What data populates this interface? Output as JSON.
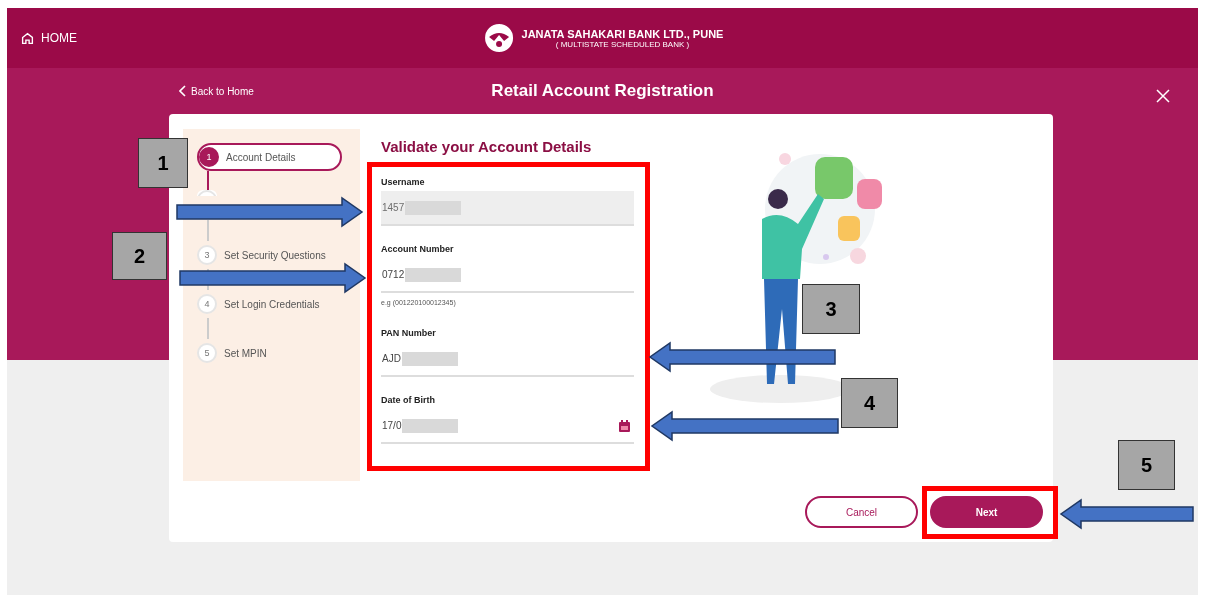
{
  "header": {
    "home_label": "HOME",
    "bank_name": "JANATA SAHAKARI BANK LTD., PUNE",
    "bank_subtitle": "( MULTISTATE SCHEDULED BANK )"
  },
  "subheader": {
    "back_label": "Back to Home",
    "title": "Retail Account Registration"
  },
  "steps": [
    {
      "number": "1",
      "label": "Account Details",
      "selected": true
    },
    {
      "selected": false
    },
    {
      "number": "3",
      "label": "Set Security Questions",
      "selected": false
    },
    {
      "number": "4",
      "label": "Set Login Credentials",
      "selected": false
    },
    {
      "number": "5",
      "label": "Set MPIN",
      "selected": false
    }
  ],
  "form": {
    "heading": "Validate your Account Details",
    "fields": [
      {
        "label": "Username",
        "value": "1457",
        "disabled": true,
        "kind": "text"
      },
      {
        "label": "Account Number",
        "value": "0712",
        "hint": "e.g (001220100012345)",
        "disabled": false,
        "kind": "text"
      },
      {
        "label": "PAN Number",
        "value": "AJD",
        "disabled": false,
        "kind": "text"
      },
      {
        "label": "Date of Birth",
        "value": "17/0",
        "disabled": false,
        "kind": "date"
      }
    ]
  },
  "buttons": {
    "cancel": "Cancel",
    "next": "Next"
  },
  "annotations": [
    {
      "number": "1"
    },
    {
      "number": "2"
    },
    {
      "number": "3"
    },
    {
      "number": "4"
    },
    {
      "number": "5"
    }
  ]
}
